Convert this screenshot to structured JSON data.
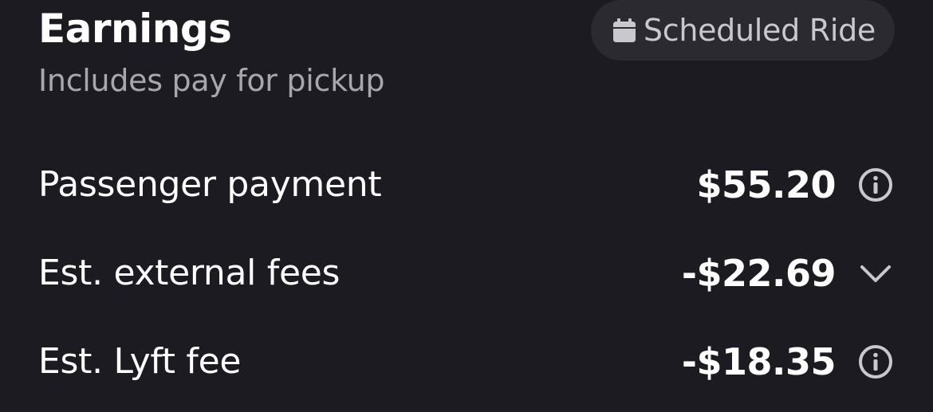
{
  "header": {
    "title": "Earnings",
    "subtitle": "Includes pay for pickup",
    "badge": {
      "icon": "calendar-icon",
      "label": "Scheduled Ride"
    }
  },
  "rows": [
    {
      "label": "Passenger payment",
      "amount": "$55.20",
      "icon": "info-icon"
    },
    {
      "label": "Est. external fees",
      "amount": "-$22.69",
      "icon": "chevron-down-icon"
    },
    {
      "label": "Est. Lyft fee",
      "amount": "-$18.35",
      "icon": "info-icon"
    }
  ],
  "colors": {
    "background": "#1c1b22",
    "badge_background": "#2b2a31",
    "primary_text": "#ffffff",
    "secondary_text": "#a8a7ad",
    "icon": "#c9c8cd"
  }
}
